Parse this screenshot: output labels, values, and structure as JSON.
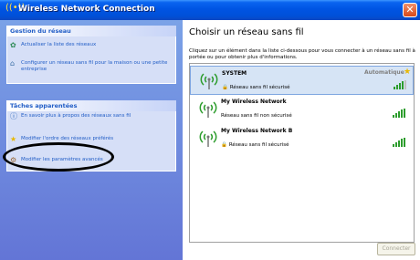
{
  "window": {
    "title": "Wireless Network Connection",
    "close_glyph": "✕"
  },
  "left": {
    "network_tasks": {
      "header": "Gestion du réseau",
      "items": [
        {
          "label": "Actualiser la liste des réseaux",
          "icon": "refresh-icon"
        },
        {
          "label": "Configurer un réseau sans fil pour la maison ou une petite entreprise",
          "icon": "setup-network-icon"
        }
      ]
    },
    "related_tasks": {
      "header": "Tâches apparentées",
      "items": [
        {
          "label": "En savoir plus à propos des réseaux sans fil",
          "icon": "info-icon"
        },
        {
          "label": "Modifier l'ordre des réseaux préférés",
          "icon": "star-icon"
        },
        {
          "label": "Modifier les paramètres avancés",
          "icon": "settings-icon"
        }
      ]
    }
  },
  "right": {
    "title": "Choisir un réseau sans fil",
    "description": "Cliquez sur un élément dans la liste ci-dessous pour vous connecter à un réseau sans fil à portée ou pour obtenir plus d'informations.",
    "networks": [
      {
        "ssid": "SYSTEM",
        "security": "Réseau sans fil sécurisé",
        "status": "Automatique",
        "secured": true,
        "selected": true,
        "signal_bars": 4
      },
      {
        "ssid": "My Wireless Network",
        "security": "Réseau sans fil non sécurisé",
        "status": "",
        "secured": false,
        "selected": false,
        "signal_bars": 5
      },
      {
        "ssid": "My Wireless Network B",
        "security": "Réseau sans fil sécurisé",
        "status": "",
        "secured": true,
        "selected": false,
        "signal_bars": 5
      }
    ],
    "connect_button": "Connecter"
  },
  "colors": {
    "titlebar": "#0054e3",
    "task_link": "#215dc6",
    "left_pane": "#7ba2e7",
    "signal": "#2c9c2c",
    "annotation": "#000000"
  }
}
